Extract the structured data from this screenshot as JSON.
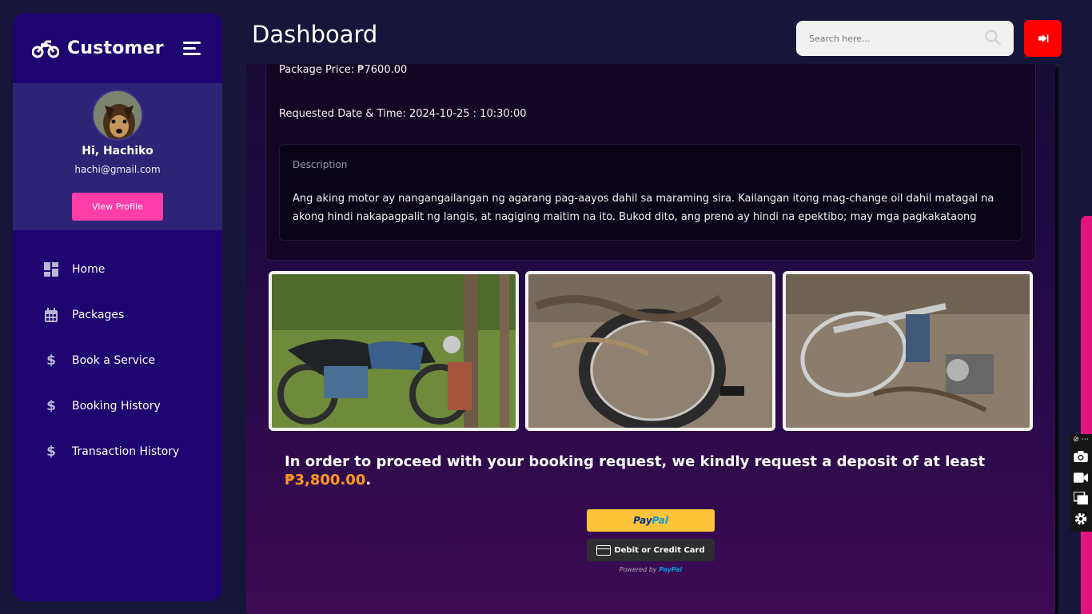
{
  "sidebar": {
    "brand": "Customer",
    "greeting": "Hi, Hachiko",
    "email": "hachi@gmail.com",
    "view_profile_label": "View Profile",
    "items": [
      {
        "label": "Home",
        "icon": "dashboard-icon"
      },
      {
        "label": "Packages",
        "icon": "calendar-icon"
      },
      {
        "label": "Book a Service",
        "icon": "dollar-icon"
      },
      {
        "label": "Booking History",
        "icon": "dollar-icon"
      },
      {
        "label": "Transaction History",
        "icon": "dollar-icon"
      }
    ]
  },
  "header": {
    "title": "Dashboard",
    "search_placeholder": "Search here..."
  },
  "details": {
    "package_price": "Package Price: ₱7600.00",
    "requested": "Requested Date & Time: 2024-10-25 : 10:30:00",
    "description_label": "Description",
    "description_text": "Ang aking motor ay nangangailangan ng agarang pag-aayos dahil sa maraming sira. Kailangan itong mag-change oil dahil matagal na akong hindi nakapagpalit ng langis, at nagiging maitim na ito. Bukod dito, ang preno ay hindi na epektibo; may mga pagkakataong"
  },
  "deposit": {
    "message": "In order to proceed with your booking request, we kindly request a deposit of at least",
    "amount": "₱3,800.00",
    "end": "."
  },
  "payment": {
    "paypal_part1": "Pay",
    "paypal_part2": "Pal",
    "card_label": "Debit or Credit Card",
    "powered_by": "Powered by",
    "powered_brand": "PayPal"
  },
  "colors": {
    "sidebar": "#1d0470",
    "accent_pink": "#ff3da8",
    "logout_red": "#ff0000",
    "amount_orange": "#ff9a1f",
    "paypal_yellow": "#ffc439"
  }
}
